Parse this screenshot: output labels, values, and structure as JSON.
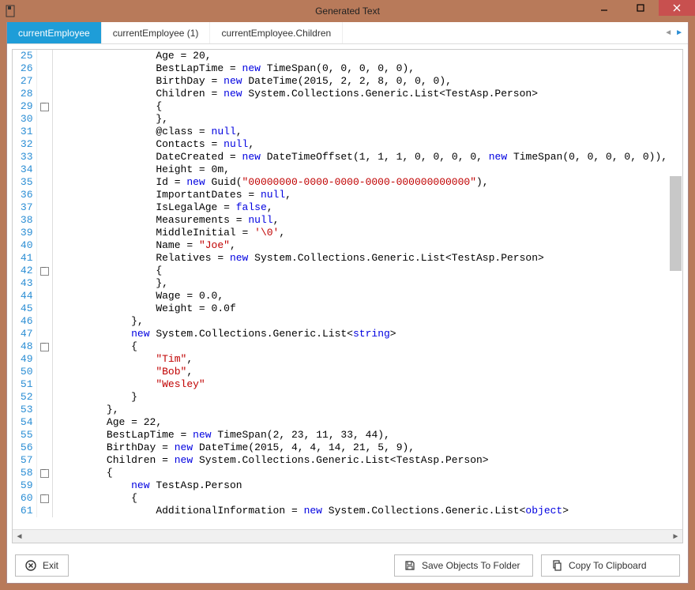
{
  "window": {
    "title": "Generated Text"
  },
  "tabs": [
    {
      "label": "currentEmployee",
      "active": true
    },
    {
      "label": "currentEmployee (1)",
      "active": false
    },
    {
      "label": "currentEmployee.Children",
      "active": false
    }
  ],
  "buttons": {
    "exit": "Exit",
    "save_folder": "Save Objects To Folder",
    "copy_clip": "Copy To Clipboard"
  },
  "code_lines": [
    {
      "n": 25,
      "fold": false,
      "tokens": [
        [
          "txt",
          "                Age = "
        ],
        [
          "num",
          "20"
        ],
        [
          "txt",
          ","
        ]
      ]
    },
    {
      "n": 26,
      "fold": false,
      "tokens": [
        [
          "txt",
          "                BestLapTime = "
        ],
        [
          "kw",
          "new"
        ],
        [
          "txt",
          " TimeSpan("
        ],
        [
          "num",
          "0"
        ],
        [
          "txt",
          ", "
        ],
        [
          "num",
          "0"
        ],
        [
          "txt",
          ", "
        ],
        [
          "num",
          "0"
        ],
        [
          "txt",
          ", "
        ],
        [
          "num",
          "0"
        ],
        [
          "txt",
          ", "
        ],
        [
          "num",
          "0"
        ],
        [
          "txt",
          "),"
        ]
      ]
    },
    {
      "n": 27,
      "fold": false,
      "tokens": [
        [
          "txt",
          "                BirthDay = "
        ],
        [
          "kw",
          "new"
        ],
        [
          "txt",
          " DateTime("
        ],
        [
          "num",
          "2015"
        ],
        [
          "txt",
          ", "
        ],
        [
          "num",
          "2"
        ],
        [
          "txt",
          ", "
        ],
        [
          "num",
          "2"
        ],
        [
          "txt",
          ", "
        ],
        [
          "num",
          "8"
        ],
        [
          "txt",
          ", "
        ],
        [
          "num",
          "0"
        ],
        [
          "txt",
          ", "
        ],
        [
          "num",
          "0"
        ],
        [
          "txt",
          ", "
        ],
        [
          "num",
          "0"
        ],
        [
          "txt",
          "),"
        ]
      ]
    },
    {
      "n": 28,
      "fold": false,
      "tokens": [
        [
          "txt",
          "                Children = "
        ],
        [
          "kw",
          "new"
        ],
        [
          "txt",
          " System.Collections.Generic.List<TestAsp.Person>"
        ]
      ]
    },
    {
      "n": 29,
      "fold": true,
      "tokens": [
        [
          "txt",
          "                {"
        ]
      ]
    },
    {
      "n": 30,
      "fold": false,
      "tokens": [
        [
          "txt",
          "                },"
        ]
      ]
    },
    {
      "n": 31,
      "fold": false,
      "tokens": [
        [
          "txt",
          "                @class = "
        ],
        [
          "kw",
          "null"
        ],
        [
          "txt",
          ","
        ]
      ]
    },
    {
      "n": 32,
      "fold": false,
      "tokens": [
        [
          "txt",
          "                Contacts = "
        ],
        [
          "kw",
          "null"
        ],
        [
          "txt",
          ","
        ]
      ]
    },
    {
      "n": 33,
      "fold": false,
      "tokens": [
        [
          "txt",
          "                DateCreated = "
        ],
        [
          "kw",
          "new"
        ],
        [
          "txt",
          " DateTimeOffset("
        ],
        [
          "num",
          "1"
        ],
        [
          "txt",
          ", "
        ],
        [
          "num",
          "1"
        ],
        [
          "txt",
          ", "
        ],
        [
          "num",
          "1"
        ],
        [
          "txt",
          ", "
        ],
        [
          "num",
          "0"
        ],
        [
          "txt",
          ", "
        ],
        [
          "num",
          "0"
        ],
        [
          "txt",
          ", "
        ],
        [
          "num",
          "0"
        ],
        [
          "txt",
          ", "
        ],
        [
          "num",
          "0"
        ],
        [
          "txt",
          ", "
        ],
        [
          "kw",
          "new"
        ],
        [
          "txt",
          " TimeSpan("
        ],
        [
          "num",
          "0"
        ],
        [
          "txt",
          ", "
        ],
        [
          "num",
          "0"
        ],
        [
          "txt",
          ", "
        ],
        [
          "num",
          "0"
        ],
        [
          "txt",
          ", "
        ],
        [
          "num",
          "0"
        ],
        [
          "txt",
          ", "
        ],
        [
          "num",
          "0"
        ],
        [
          "txt",
          ")),"
        ]
      ]
    },
    {
      "n": 34,
      "fold": false,
      "tokens": [
        [
          "txt",
          "                Height = "
        ],
        [
          "num",
          "0m"
        ],
        [
          "txt",
          ","
        ]
      ]
    },
    {
      "n": 35,
      "fold": false,
      "tokens": [
        [
          "txt",
          "                Id = "
        ],
        [
          "kw",
          "new"
        ],
        [
          "txt",
          " Guid("
        ],
        [
          "str",
          "\"00000000-0000-0000-0000-000000000000\""
        ],
        [
          "txt",
          "),"
        ]
      ]
    },
    {
      "n": 36,
      "fold": false,
      "tokens": [
        [
          "txt",
          "                ImportantDates = "
        ],
        [
          "kw",
          "null"
        ],
        [
          "txt",
          ","
        ]
      ]
    },
    {
      "n": 37,
      "fold": false,
      "tokens": [
        [
          "txt",
          "                IsLegalAge = "
        ],
        [
          "kw",
          "false"
        ],
        [
          "txt",
          ","
        ]
      ]
    },
    {
      "n": 38,
      "fold": false,
      "tokens": [
        [
          "txt",
          "                Measurements = "
        ],
        [
          "kw",
          "null"
        ],
        [
          "txt",
          ","
        ]
      ]
    },
    {
      "n": 39,
      "fold": false,
      "tokens": [
        [
          "txt",
          "                MiddleInitial = "
        ],
        [
          "str",
          "'\\0'"
        ],
        [
          "txt",
          ","
        ]
      ]
    },
    {
      "n": 40,
      "fold": false,
      "tokens": [
        [
          "txt",
          "                Name = "
        ],
        [
          "str",
          "\"Joe\""
        ],
        [
          "txt",
          ","
        ]
      ]
    },
    {
      "n": 41,
      "fold": false,
      "tokens": [
        [
          "txt",
          "                Relatives = "
        ],
        [
          "kw",
          "new"
        ],
        [
          "txt",
          " System.Collections.Generic.List<TestAsp.Person>"
        ]
      ]
    },
    {
      "n": 42,
      "fold": true,
      "tokens": [
        [
          "txt",
          "                {"
        ]
      ]
    },
    {
      "n": 43,
      "fold": false,
      "tokens": [
        [
          "txt",
          "                },"
        ]
      ]
    },
    {
      "n": 44,
      "fold": false,
      "tokens": [
        [
          "txt",
          "                Wage = "
        ],
        [
          "num",
          "0.0"
        ],
        [
          "txt",
          ","
        ]
      ]
    },
    {
      "n": 45,
      "fold": false,
      "tokens": [
        [
          "txt",
          "                Weight = "
        ],
        [
          "num",
          "0.0f"
        ]
      ]
    },
    {
      "n": 46,
      "fold": false,
      "tokens": [
        [
          "txt",
          "            },"
        ]
      ]
    },
    {
      "n": 47,
      "fold": false,
      "tokens": [
        [
          "txt",
          "            "
        ],
        [
          "kw",
          "new"
        ],
        [
          "txt",
          " System.Collections.Generic.List<"
        ],
        [
          "kw",
          "string"
        ],
        [
          "txt",
          ">"
        ]
      ]
    },
    {
      "n": 48,
      "fold": true,
      "tokens": [
        [
          "txt",
          "            {"
        ]
      ]
    },
    {
      "n": 49,
      "fold": false,
      "tokens": [
        [
          "txt",
          "                "
        ],
        [
          "str",
          "\"Tim\""
        ],
        [
          "txt",
          ","
        ]
      ]
    },
    {
      "n": 50,
      "fold": false,
      "tokens": [
        [
          "txt",
          "                "
        ],
        [
          "str",
          "\"Bob\""
        ],
        [
          "txt",
          ","
        ]
      ]
    },
    {
      "n": 51,
      "fold": false,
      "tokens": [
        [
          "txt",
          "                "
        ],
        [
          "str",
          "\"Wesley\""
        ]
      ]
    },
    {
      "n": 52,
      "fold": false,
      "tokens": [
        [
          "txt",
          "            }"
        ]
      ]
    },
    {
      "n": 53,
      "fold": false,
      "tokens": [
        [
          "txt",
          "        },"
        ]
      ]
    },
    {
      "n": 54,
      "fold": false,
      "tokens": [
        [
          "txt",
          "        Age = "
        ],
        [
          "num",
          "22"
        ],
        [
          "txt",
          ","
        ]
      ]
    },
    {
      "n": 55,
      "fold": false,
      "tokens": [
        [
          "txt",
          "        BestLapTime = "
        ],
        [
          "kw",
          "new"
        ],
        [
          "txt",
          " TimeSpan("
        ],
        [
          "num",
          "2"
        ],
        [
          "txt",
          ", "
        ],
        [
          "num",
          "23"
        ],
        [
          "txt",
          ", "
        ],
        [
          "num",
          "11"
        ],
        [
          "txt",
          ", "
        ],
        [
          "num",
          "33"
        ],
        [
          "txt",
          ", "
        ],
        [
          "num",
          "44"
        ],
        [
          "txt",
          "),"
        ]
      ]
    },
    {
      "n": 56,
      "fold": false,
      "tokens": [
        [
          "txt",
          "        BirthDay = "
        ],
        [
          "kw",
          "new"
        ],
        [
          "txt",
          " DateTime("
        ],
        [
          "num",
          "2015"
        ],
        [
          "txt",
          ", "
        ],
        [
          "num",
          "4"
        ],
        [
          "txt",
          ", "
        ],
        [
          "num",
          "4"
        ],
        [
          "txt",
          ", "
        ],
        [
          "num",
          "14"
        ],
        [
          "txt",
          ", "
        ],
        [
          "num",
          "21"
        ],
        [
          "txt",
          ", "
        ],
        [
          "num",
          "5"
        ],
        [
          "txt",
          ", "
        ],
        [
          "num",
          "9"
        ],
        [
          "txt",
          "),"
        ]
      ]
    },
    {
      "n": 57,
      "fold": false,
      "tokens": [
        [
          "txt",
          "        Children = "
        ],
        [
          "kw",
          "new"
        ],
        [
          "txt",
          " System.Collections.Generic.List<TestAsp.Person>"
        ]
      ]
    },
    {
      "n": 58,
      "fold": true,
      "tokens": [
        [
          "txt",
          "        {"
        ]
      ]
    },
    {
      "n": 59,
      "fold": false,
      "tokens": [
        [
          "txt",
          "            "
        ],
        [
          "kw",
          "new"
        ],
        [
          "txt",
          " TestAsp.Person"
        ]
      ]
    },
    {
      "n": 60,
      "fold": true,
      "tokens": [
        [
          "txt",
          "            {"
        ]
      ]
    },
    {
      "n": 61,
      "fold": false,
      "tokens": [
        [
          "txt",
          "                AdditionalInformation = "
        ],
        [
          "kw",
          "new"
        ],
        [
          "txt",
          " System.Collections.Generic.List<"
        ],
        [
          "kw",
          "object"
        ],
        [
          "txt",
          ">"
        ]
      ]
    }
  ]
}
